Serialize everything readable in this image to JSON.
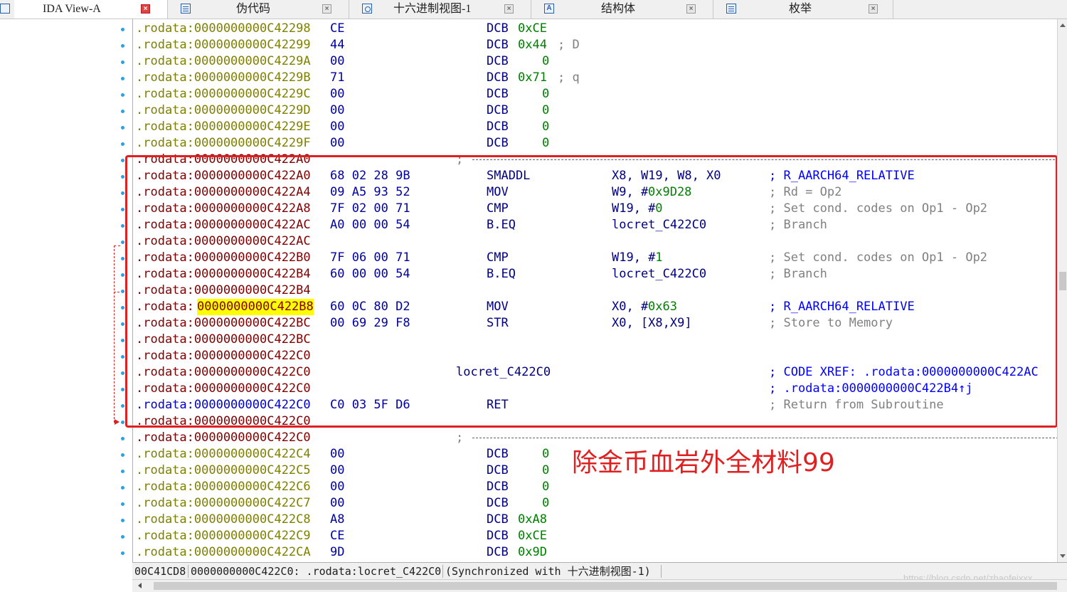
{
  "tabs": [
    {
      "label": "IDA View-A",
      "active": true,
      "icon": "ida-view-icon"
    },
    {
      "label": "伪代码",
      "active": false,
      "icon": "pseudocode-icon"
    },
    {
      "label": "十六进制视图-1",
      "active": false,
      "icon": "hex-view-icon"
    },
    {
      "label": "结构体",
      "active": false,
      "icon": "structures-icon"
    },
    {
      "label": "枚举",
      "active": false,
      "icon": "enums-icon"
    }
  ],
  "close_glyph": "×",
  "listing": [
    {
      "addr": ".rodata:0000000000C42298",
      "bytes": "CE",
      "mnem": "DCB",
      "op": "0xCE",
      "comment": "",
      "color": "olive"
    },
    {
      "addr": ".rodata:0000000000C42299",
      "bytes": "44",
      "mnem": "DCB",
      "op": "0x44",
      "comment": "; D",
      "color": "olive"
    },
    {
      "addr": ".rodata:0000000000C4229A",
      "bytes": "00",
      "mnem": "DCB",
      "op": "0",
      "comment": "",
      "color": "olive"
    },
    {
      "addr": ".rodata:0000000000C4229B",
      "bytes": "71",
      "mnem": "DCB",
      "op": "0x71",
      "comment": "; q",
      "color": "olive"
    },
    {
      "addr": ".rodata:0000000000C4229C",
      "bytes": "00",
      "mnem": "DCB",
      "op": "0",
      "comment": "",
      "color": "olive"
    },
    {
      "addr": ".rodata:0000000000C4229D",
      "bytes": "00",
      "mnem": "DCB",
      "op": "0",
      "comment": "",
      "color": "olive"
    },
    {
      "addr": ".rodata:0000000000C4229E",
      "bytes": "00",
      "mnem": "DCB",
      "op": "0",
      "comment": "",
      "color": "olive"
    },
    {
      "addr": ".rodata:0000000000C4229F",
      "bytes": "00",
      "mnem": "DCB",
      "op": "0",
      "comment": "",
      "color": "olive"
    },
    {
      "addr": ".rodata:0000000000C422A0",
      "sep": true,
      "color": "red"
    },
    {
      "addr": ".rodata:0000000000C422A0",
      "bytes": "68 02 28 9B",
      "mnem": "SMADDL",
      "op": "X8, W19, W8, X0",
      "comment": "; R_AARCH64_RELATIVE",
      "comment_blue": true,
      "color": "red"
    },
    {
      "addr": ".rodata:0000000000C422A4",
      "bytes": "09 A5 93 52",
      "mnem": "MOV",
      "op_pre": "W9, #",
      "op_num": "0x9D28",
      "comment": "; Rd = Op2",
      "color": "red"
    },
    {
      "addr": ".rodata:0000000000C422A8",
      "bytes": "7F 02 00 71",
      "mnem": "CMP",
      "op_pre": "W19, #",
      "op_num": "0",
      "comment": "; Set cond. codes on Op1 - Op2",
      "color": "red"
    },
    {
      "addr": ".rodata:0000000000C422AC",
      "bytes": "A0 00 00 54",
      "mnem": "B.EQ",
      "op": "locret_C422C0",
      "comment": "; Branch",
      "color": "red"
    },
    {
      "addr": ".rodata:0000000000C422AC",
      "color": "red"
    },
    {
      "addr": ".rodata:0000000000C422B0",
      "bytes": "7F 06 00 71",
      "mnem": "CMP",
      "op_pre": "W19, #",
      "op_num": "1",
      "comment": "; Set cond. codes on Op1 - Op2",
      "color": "red"
    },
    {
      "addr": ".rodata:0000000000C422B4",
      "bytes": "60 00 00 54",
      "mnem": "B.EQ",
      "op": "locret_C422C0",
      "comment": "; Branch",
      "color": "red"
    },
    {
      "addr": ".rodata:0000000000C422B4",
      "color": "red"
    },
    {
      "addr_pre": ".rodata:",
      "addr_hl": "0000000000C422B8",
      "bytes": "60 0C 80 D2",
      "mnem": "MOV",
      "op_pre": "X0, #",
      "op_num": "0x63",
      "comment": "; R_AARCH64_RELATIVE",
      "comment_blue": true,
      "color": "red"
    },
    {
      "addr": ".rodata:0000000000C422BC",
      "bytes": "00 69 29 F8",
      "mnem": "STR",
      "op": "X0, [X8,X9]",
      "comment": "; Store to Memory",
      "color": "red"
    },
    {
      "addr": ".rodata:0000000000C422BC",
      "color": "red"
    },
    {
      "addr": ".rodata:0000000000C422C0",
      "color": "red"
    },
    {
      "addr": ".rodata:0000000000C422C0",
      "label": "locret_C422C0",
      "comment": "; CODE XREF: .rodata:0000000000C422AC",
      "comment_blue": true,
      "color": "red"
    },
    {
      "addr": ".rodata:0000000000C422C0",
      "comment": "; .rodata:0000000000C422B4↑j",
      "comment_blue": true,
      "color": "red"
    },
    {
      "addr": ".rodata:0000000000C422C0",
      "bytes": "C0 03 5F D6",
      "mnem": "RET",
      "comment": "; Return from Subroutine",
      "color": "blue"
    },
    {
      "addr": ".rodata:0000000000C422C0",
      "color": "red"
    },
    {
      "addr": ".rodata:0000000000C422C0",
      "sep": true,
      "color": "red"
    },
    {
      "addr": ".rodata:0000000000C422C4",
      "bytes": "00",
      "mnem": "DCB",
      "op": "0",
      "comment": "",
      "color": "olive"
    },
    {
      "addr": ".rodata:0000000000C422C5",
      "bytes": "00",
      "mnem": "DCB",
      "op": "0",
      "comment": "",
      "color": "olive"
    },
    {
      "addr": ".rodata:0000000000C422C6",
      "bytes": "00",
      "mnem": "DCB",
      "op": "0",
      "comment": "",
      "color": "olive"
    },
    {
      "addr": ".rodata:0000000000C422C7",
      "bytes": "00",
      "mnem": "DCB",
      "op": "0",
      "comment": "",
      "color": "olive"
    },
    {
      "addr": ".rodata:0000000000C422C8",
      "bytes": "A8",
      "mnem": "DCB",
      "op": "0xA8",
      "comment": "",
      "color": "olive"
    },
    {
      "addr": ".rodata:0000000000C422C9",
      "bytes": "CE",
      "mnem": "DCB",
      "op": "0xCE",
      "comment": "",
      "color": "olive"
    },
    {
      "addr": ".rodata:0000000000C422CA",
      "bytes": "9D",
      "mnem": "DCB",
      "op": "0x9D",
      "comment": "",
      "color": "olive"
    }
  ],
  "annotation": {
    "text": "除金币血岩外全材料99",
    "color": "#e02020"
  },
  "status": {
    "offset": "00C41CD8",
    "location": "0000000000C422C0: .rodata:locret_C422C0",
    "sync": "(Synchronized with 十六进制视图-1)"
  },
  "watermark": "https://blog.csdn.net/zhaofeixxx",
  "colors": {
    "accent": "#e02020",
    "address_code": "#800000",
    "address_data": "#808000",
    "highlight": "#ffff00"
  }
}
